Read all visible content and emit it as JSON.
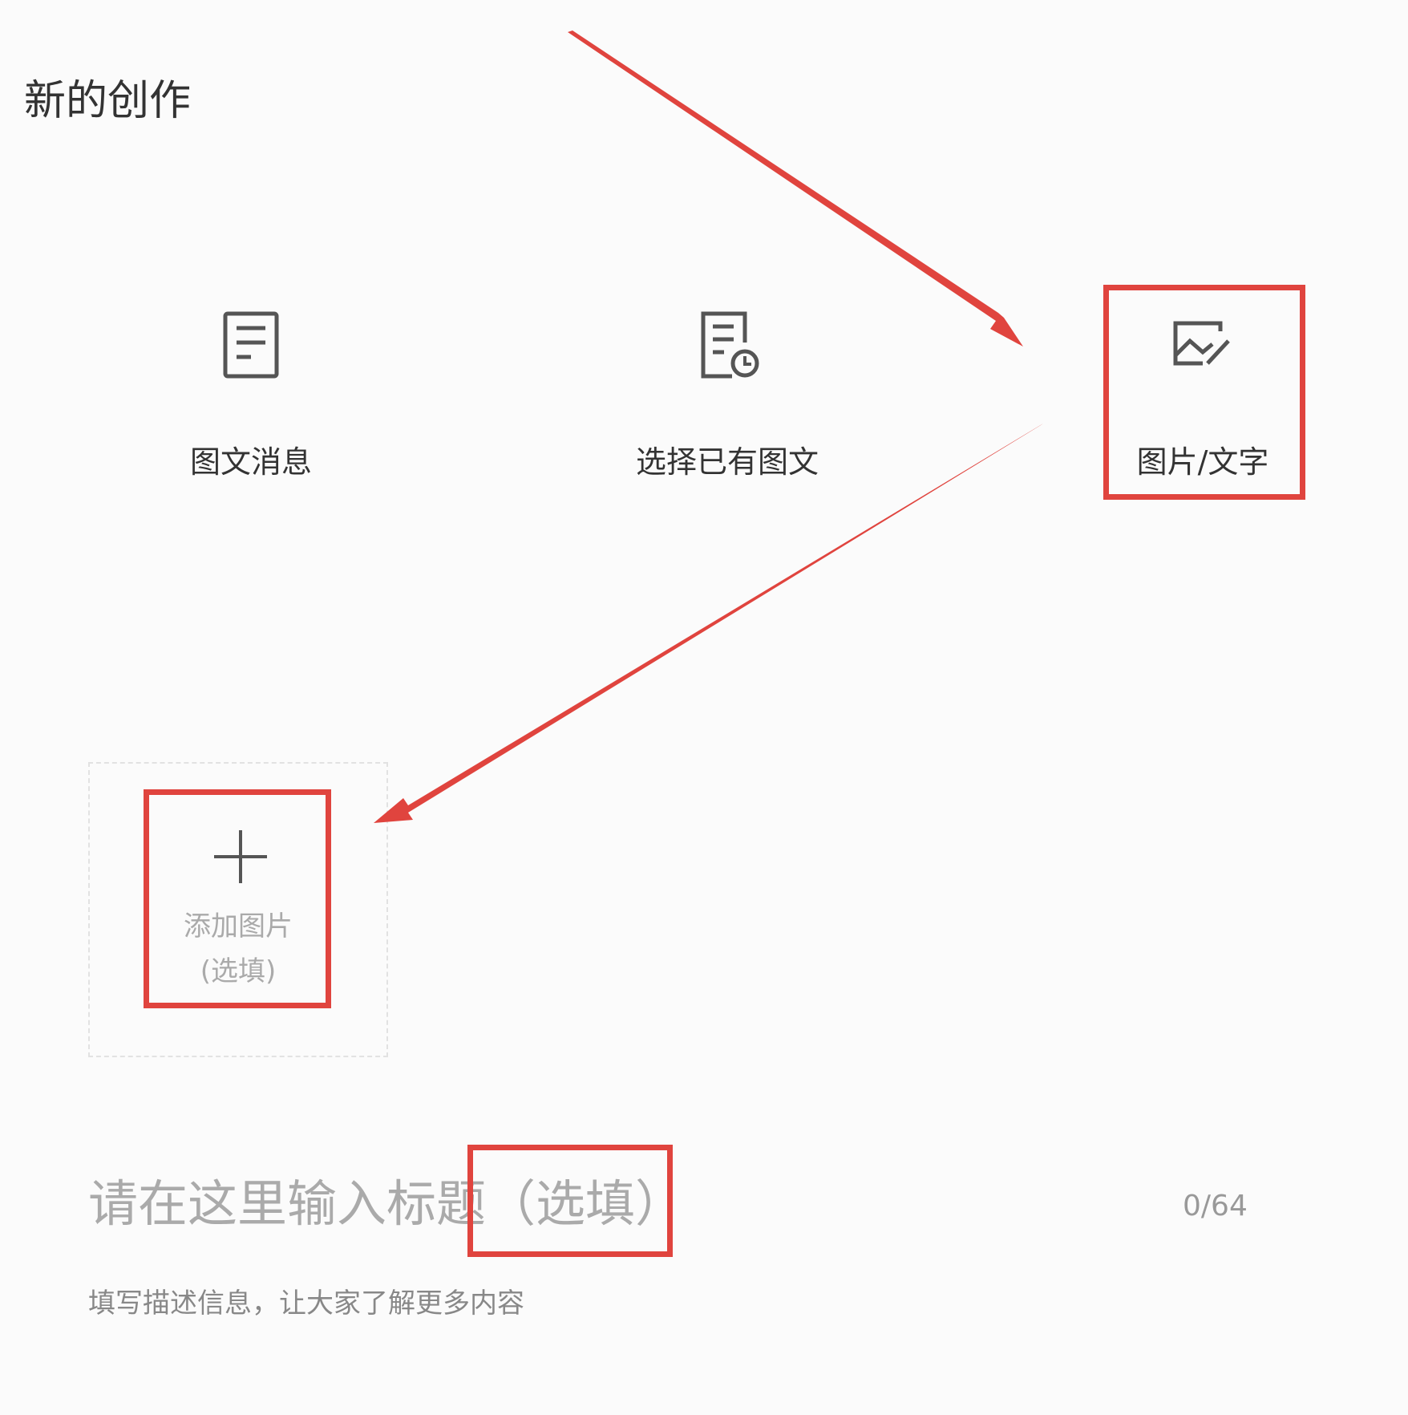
{
  "page": {
    "title": "新的创作"
  },
  "create_options": [
    {
      "label": "图文消息",
      "icon": "document-icon"
    },
    {
      "label": "选择已有图文",
      "icon": "document-clock-icon"
    },
    {
      "label": "图片/文字",
      "icon": "image-text-icon"
    }
  ],
  "upload": {
    "label_line1": "添加图片",
    "label_line2": "(选填)",
    "icon": "plus-icon"
  },
  "title_field": {
    "placeholder": "请在这里输入标题（选填）",
    "value": "",
    "counter": "0/64"
  },
  "description_field": {
    "placeholder": "填写描述信息，让大家了解更多内容",
    "value": ""
  },
  "annotation": {
    "color": "#e0443e"
  }
}
